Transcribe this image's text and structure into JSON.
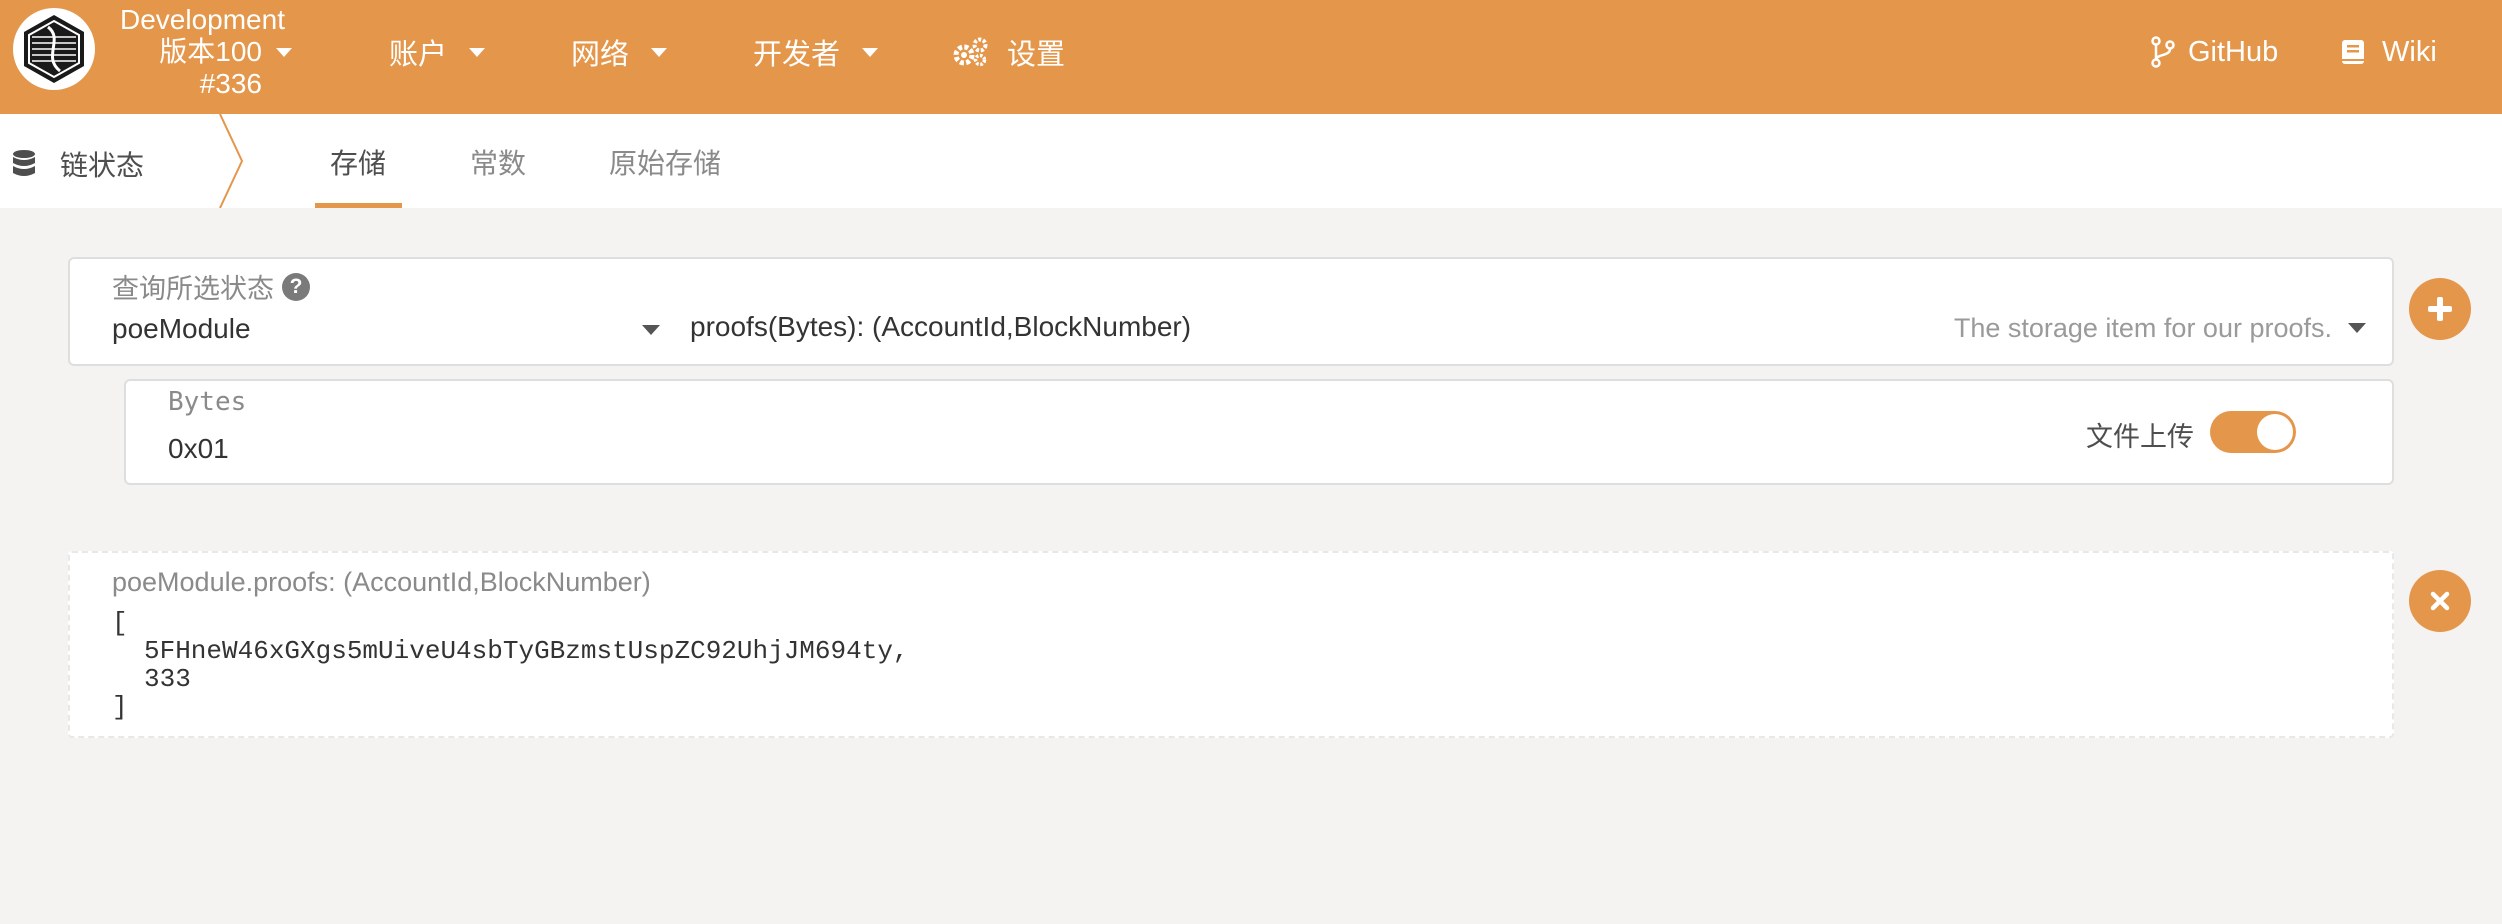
{
  "colors": {
    "accent": "#e4964a",
    "background": "#f4f3f2",
    "panel": "#ffffff"
  },
  "topbar": {
    "chain_name": "Development",
    "version": "版本100",
    "block": "#336",
    "nav": [
      {
        "label": "账户",
        "icon": "chevron-down-icon"
      },
      {
        "label": "网络",
        "icon": "chevron-down-icon"
      },
      {
        "label": "开发者",
        "icon": "chevron-down-icon"
      },
      {
        "label": "设置",
        "icon": "gears-icon"
      }
    ],
    "links": [
      {
        "label": "GitHub",
        "icon": "code-branch-icon"
      },
      {
        "label": "Wiki",
        "icon": "book-icon"
      }
    ]
  },
  "subnav": {
    "section": "链状态",
    "section_icon": "database-icon",
    "tabs": [
      {
        "label": "存储",
        "active": true
      },
      {
        "label": "常数",
        "active": false
      },
      {
        "label": "原始存储",
        "active": false
      }
    ]
  },
  "query": {
    "label": "查询所选状态",
    "help_icon": "?",
    "module": "poeModule",
    "method": "proofs(Bytes): (AccountId,BlockNumber)",
    "method_doc": "The storage item for our proofs.",
    "add_icon": "plus-icon"
  },
  "param": {
    "label": "Bytes",
    "value": "0x01",
    "toggle_label": "文件上传",
    "toggle_on": true
  },
  "result": {
    "title": "poeModule.proofs: (AccountId,BlockNumber)",
    "open": "[",
    "line1": "5FHneW46xGXgs5mUiveU4sbTyGBzmstUspZC92UhjJM694ty,",
    "line2": "333",
    "close": "]",
    "remove_icon": "close-icon"
  }
}
